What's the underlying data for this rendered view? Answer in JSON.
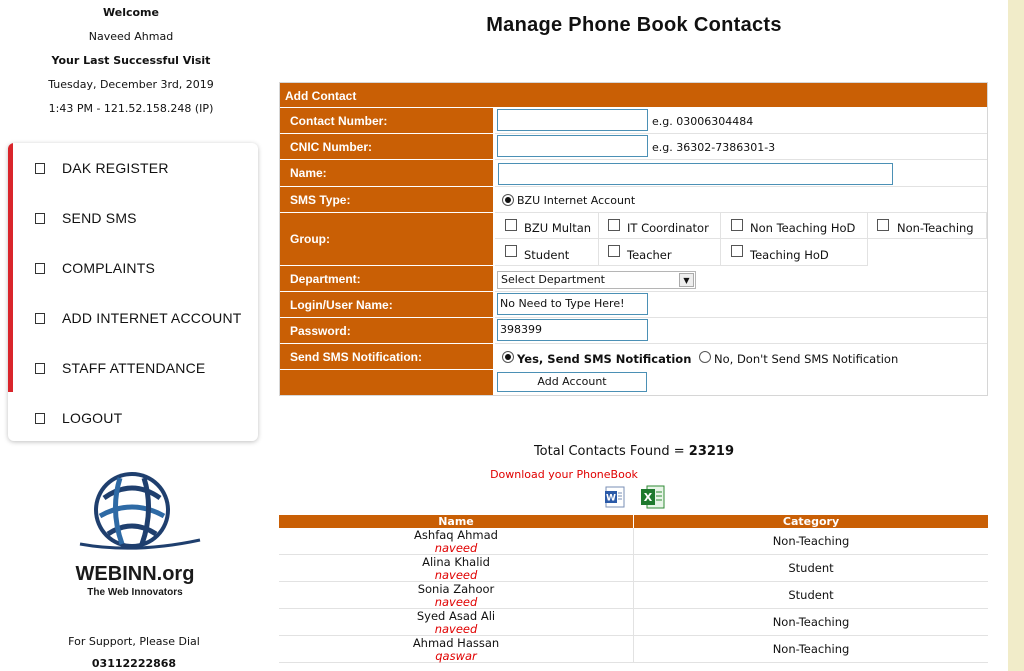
{
  "sidebar": {
    "welcome": "Welcome",
    "user_name": "Naveed Ahmad",
    "last_visit_label": "Your Last Successful Visit",
    "last_visit_date": "Tuesday, December 3rd, 2019",
    "last_visit_time": "1:43 PM - 121.52.158.248 (IP)",
    "menu": [
      "DAK REGISTER",
      "SEND SMS",
      "COMPLAINTS",
      "ADD INTERNET ACCOUNT",
      "STAFF ATTENDANCE",
      "LOGOUT"
    ],
    "accent_color": "#d9252b",
    "logo_text": "WEBINN.org",
    "logo_tagline": "The Web Innovators",
    "support_text": "For Support, Please Dial",
    "support_number": "03112222868"
  },
  "page_title": "Manage Phone Book Contacts",
  "form": {
    "header": "Add Contact",
    "contact_number_label": "Contact Number:",
    "contact_number_value": "",
    "contact_number_hint": "e.g. 03006304484",
    "cnic_label": "CNIC Number:",
    "cnic_value": "",
    "cnic_hint": "e.g. 36302-7386301-3",
    "name_label": "Name:",
    "name_value": "",
    "sms_type_label": "SMS Type:",
    "sms_type_option": "BZU Internet Account",
    "group_label": "Group:",
    "groups": [
      "BZU Multan",
      "IT Coordinator",
      "Non Teaching HoD",
      "Non-Teaching",
      "Student",
      "Teacher",
      "Teaching HoD"
    ],
    "department_label": "Department:",
    "department_value": "Select Department",
    "login_label": "Login/User Name:",
    "login_value": "No Need to Type Here!",
    "password_label": "Password:",
    "password_value": "398399",
    "notification_label": "Send SMS Notification:",
    "notify_yes": "Yes, Send SMS Notification",
    "notify_no": "No, Don't Send SMS Notification",
    "submit": "Add Account",
    "header_color": "#c95f05"
  },
  "summary": {
    "total_label": "Total Contacts Found = ",
    "total_count": "23219",
    "download_link": "Download your PhoneBook",
    "word_icon": "word-doc-icon",
    "excel_icon": "excel-icon"
  },
  "table": {
    "columns": [
      "Name",
      "Category"
    ],
    "rows": [
      {
        "name": "Ashfaq Ahmad",
        "user": "naveed",
        "category": "Non-Teaching"
      },
      {
        "name": "Alina Khalid",
        "user": "naveed",
        "category": "Student"
      },
      {
        "name": "Sonia Zahoor",
        "user": "naveed",
        "category": "Student"
      },
      {
        "name": "Syed Asad Ali",
        "user": "naveed",
        "category": "Non-Teaching"
      },
      {
        "name": "Ahmad Hassan",
        "user": "qaswar",
        "category": "Non-Teaching"
      }
    ]
  }
}
